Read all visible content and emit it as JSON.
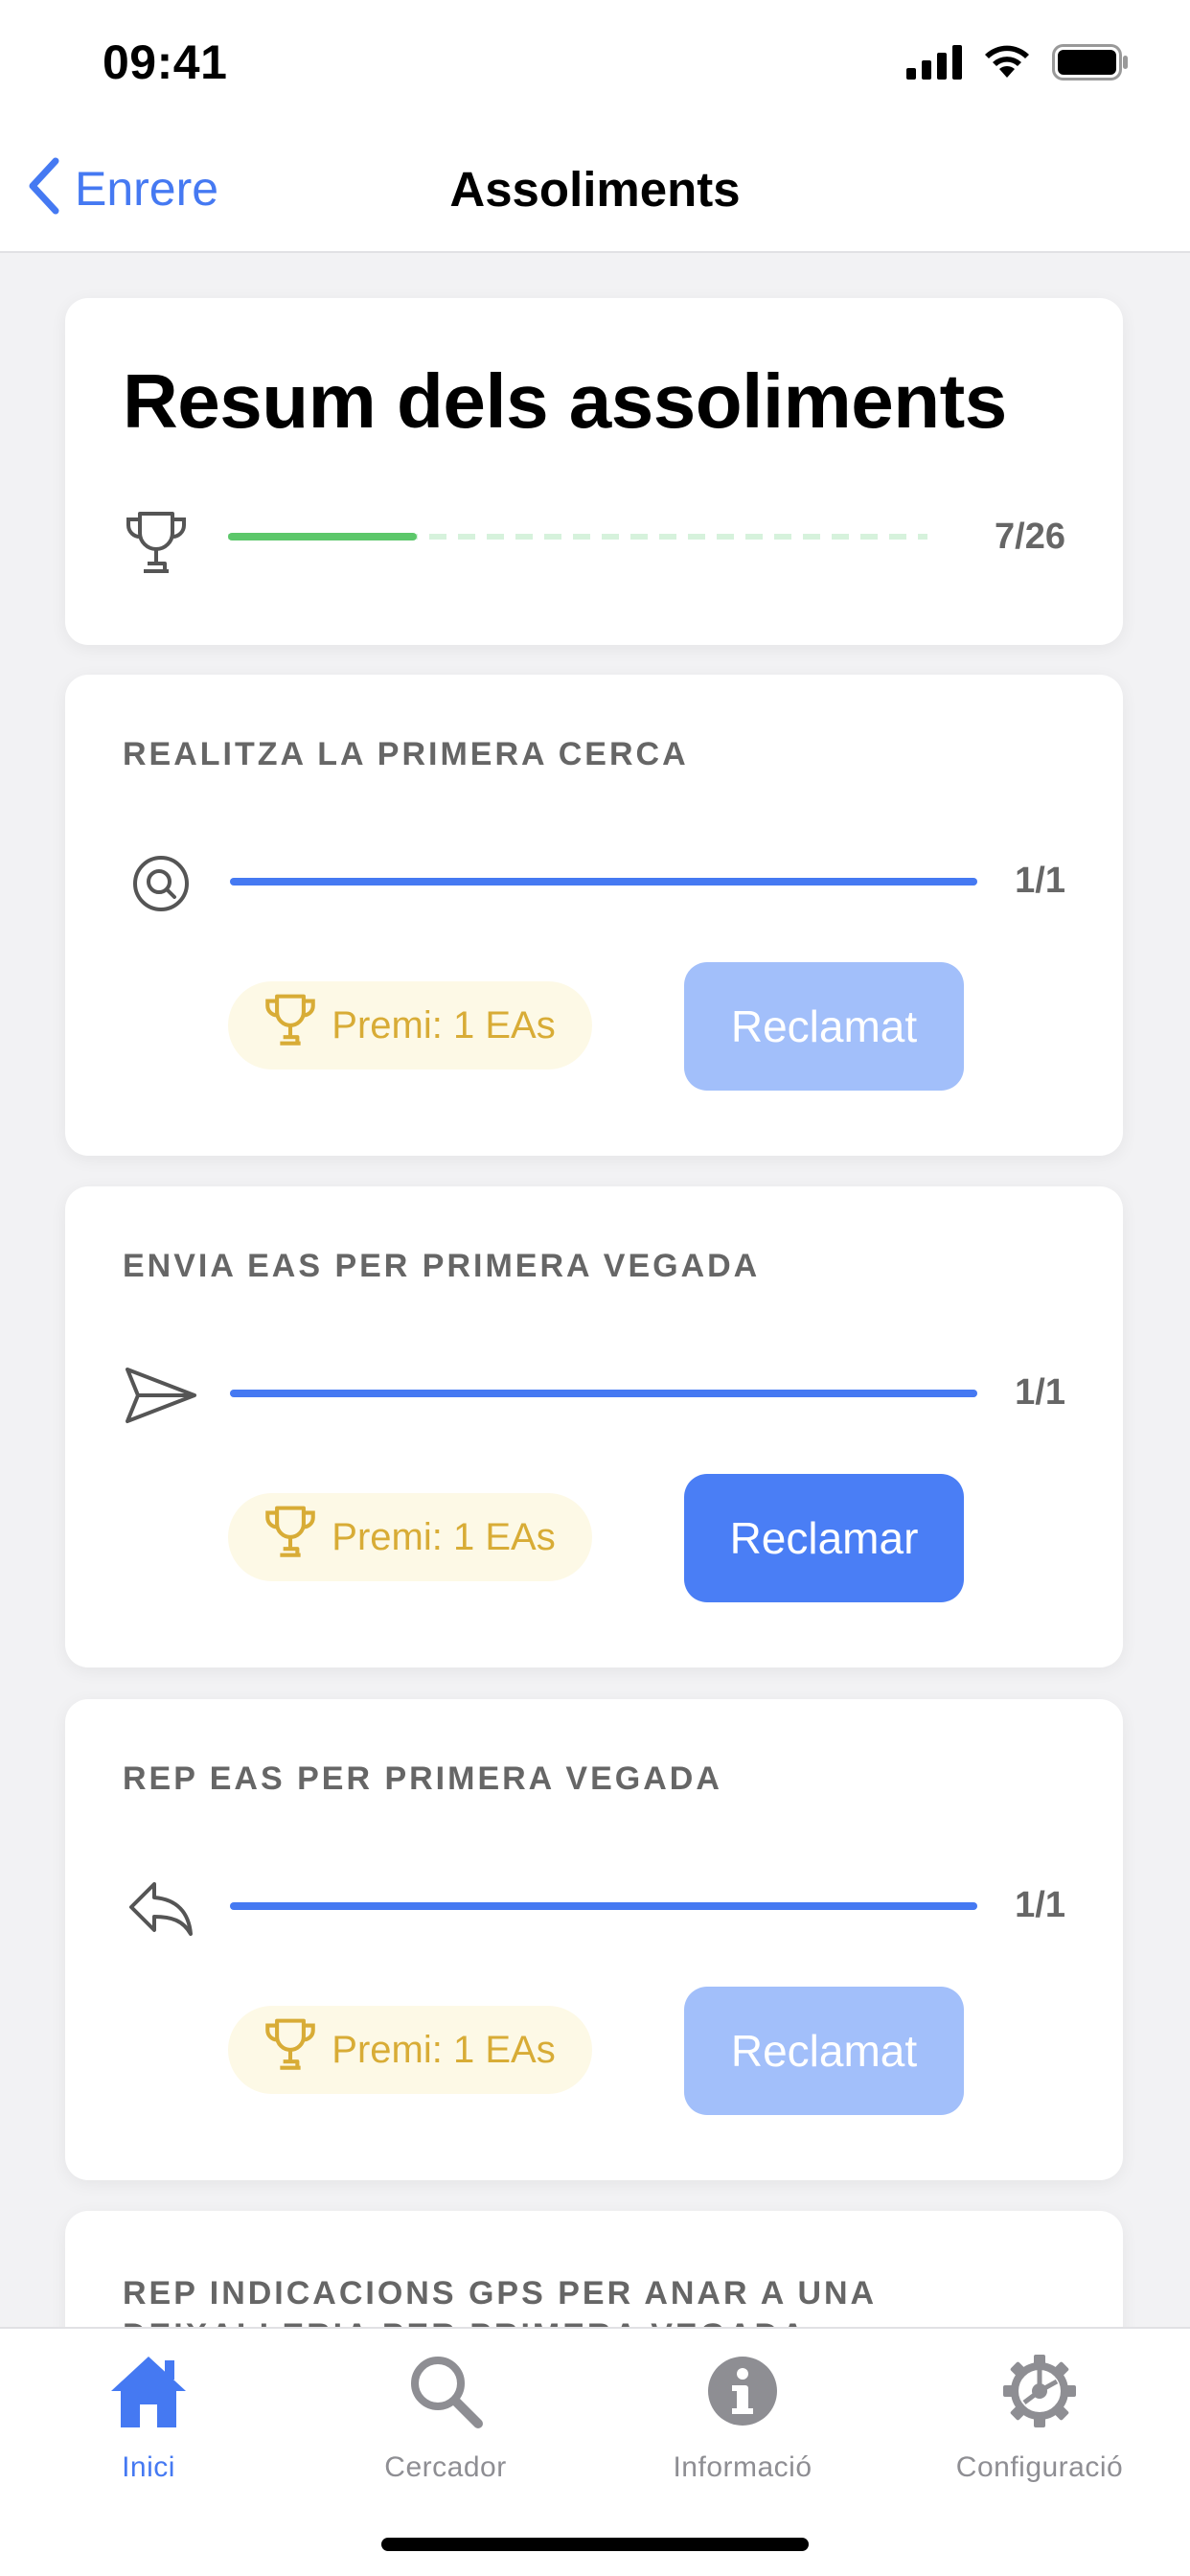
{
  "status": {
    "time": "09:41"
  },
  "nav": {
    "back_label": "Enrere",
    "title": "Assoliments"
  },
  "summary": {
    "title": "Resum dels assoliments",
    "count": "7/26",
    "progress_fraction": 0.27
  },
  "achievements": [
    {
      "title": "Realitza la primera cerca",
      "icon": "search-at-icon",
      "count": "1/1",
      "progress_fraction": 1.0,
      "reward": "Premi: 1 EAs",
      "button": "Reclamat",
      "state": "claimed"
    },
    {
      "title": "Envia EAs per primera vegada",
      "icon": "send-icon",
      "count": "1/1",
      "progress_fraction": 1.0,
      "reward": "Premi: 1 EAs",
      "button": "Reclamar",
      "state": "active"
    },
    {
      "title": "Rep EAs per primera vegada",
      "icon": "reply-icon",
      "count": "1/1",
      "progress_fraction": 1.0,
      "reward": "Premi: 1 EAs",
      "button": "Reclamat",
      "state": "claimed"
    },
    {
      "title": "Rep indicacions GPS per anar a una deixalleria per primera vegada"
    }
  ],
  "tabs": [
    {
      "label": "Inici",
      "icon": "home-icon",
      "active": true
    },
    {
      "label": "Cercador",
      "icon": "search-icon",
      "active": false
    },
    {
      "label": "Informació",
      "icon": "info-icon",
      "active": false
    },
    {
      "label": "Configuració",
      "icon": "settings-icon",
      "active": false
    }
  ],
  "colors": {
    "accent": "#4579f2",
    "claimed": "#a2bffa",
    "summary_progress": "#5cc76a",
    "reward_text": "#d8ac36",
    "reward_bg": "#fdf9e6"
  }
}
